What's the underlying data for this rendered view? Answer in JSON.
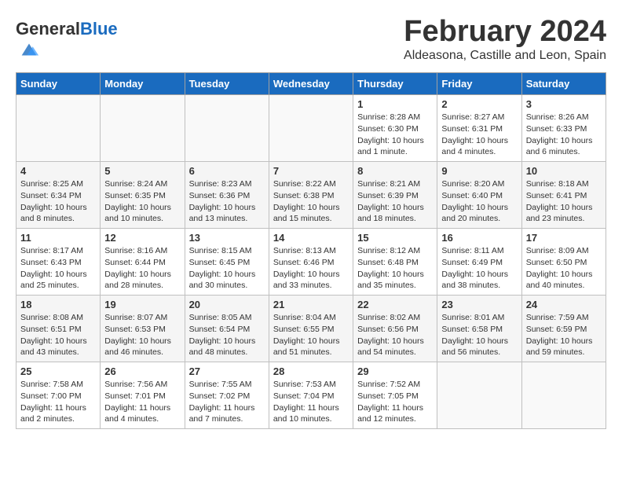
{
  "header": {
    "logo_general": "General",
    "logo_blue": "Blue",
    "month_title": "February 2024",
    "location": "Aldeasona, Castille and Leon, Spain"
  },
  "weekdays": [
    "Sunday",
    "Monday",
    "Tuesday",
    "Wednesday",
    "Thursday",
    "Friday",
    "Saturday"
  ],
  "weeks": [
    [
      {
        "day": "",
        "content": ""
      },
      {
        "day": "",
        "content": ""
      },
      {
        "day": "",
        "content": ""
      },
      {
        "day": "",
        "content": ""
      },
      {
        "day": "1",
        "content": "Sunrise: 8:28 AM\nSunset: 6:30 PM\nDaylight: 10 hours\nand 1 minute."
      },
      {
        "day": "2",
        "content": "Sunrise: 8:27 AM\nSunset: 6:31 PM\nDaylight: 10 hours\nand 4 minutes."
      },
      {
        "day": "3",
        "content": "Sunrise: 8:26 AM\nSunset: 6:33 PM\nDaylight: 10 hours\nand 6 minutes."
      }
    ],
    [
      {
        "day": "4",
        "content": "Sunrise: 8:25 AM\nSunset: 6:34 PM\nDaylight: 10 hours\nand 8 minutes."
      },
      {
        "day": "5",
        "content": "Sunrise: 8:24 AM\nSunset: 6:35 PM\nDaylight: 10 hours\nand 10 minutes."
      },
      {
        "day": "6",
        "content": "Sunrise: 8:23 AM\nSunset: 6:36 PM\nDaylight: 10 hours\nand 13 minutes."
      },
      {
        "day": "7",
        "content": "Sunrise: 8:22 AM\nSunset: 6:38 PM\nDaylight: 10 hours\nand 15 minutes."
      },
      {
        "day": "8",
        "content": "Sunrise: 8:21 AM\nSunset: 6:39 PM\nDaylight: 10 hours\nand 18 minutes."
      },
      {
        "day": "9",
        "content": "Sunrise: 8:20 AM\nSunset: 6:40 PM\nDaylight: 10 hours\nand 20 minutes."
      },
      {
        "day": "10",
        "content": "Sunrise: 8:18 AM\nSunset: 6:41 PM\nDaylight: 10 hours\nand 23 minutes."
      }
    ],
    [
      {
        "day": "11",
        "content": "Sunrise: 8:17 AM\nSunset: 6:43 PM\nDaylight: 10 hours\nand 25 minutes."
      },
      {
        "day": "12",
        "content": "Sunrise: 8:16 AM\nSunset: 6:44 PM\nDaylight: 10 hours\nand 28 minutes."
      },
      {
        "day": "13",
        "content": "Sunrise: 8:15 AM\nSunset: 6:45 PM\nDaylight: 10 hours\nand 30 minutes."
      },
      {
        "day": "14",
        "content": "Sunrise: 8:13 AM\nSunset: 6:46 PM\nDaylight: 10 hours\nand 33 minutes."
      },
      {
        "day": "15",
        "content": "Sunrise: 8:12 AM\nSunset: 6:48 PM\nDaylight: 10 hours\nand 35 minutes."
      },
      {
        "day": "16",
        "content": "Sunrise: 8:11 AM\nSunset: 6:49 PM\nDaylight: 10 hours\nand 38 minutes."
      },
      {
        "day": "17",
        "content": "Sunrise: 8:09 AM\nSunset: 6:50 PM\nDaylight: 10 hours\nand 40 minutes."
      }
    ],
    [
      {
        "day": "18",
        "content": "Sunrise: 8:08 AM\nSunset: 6:51 PM\nDaylight: 10 hours\nand 43 minutes."
      },
      {
        "day": "19",
        "content": "Sunrise: 8:07 AM\nSunset: 6:53 PM\nDaylight: 10 hours\nand 46 minutes."
      },
      {
        "day": "20",
        "content": "Sunrise: 8:05 AM\nSunset: 6:54 PM\nDaylight: 10 hours\nand 48 minutes."
      },
      {
        "day": "21",
        "content": "Sunrise: 8:04 AM\nSunset: 6:55 PM\nDaylight: 10 hours\nand 51 minutes."
      },
      {
        "day": "22",
        "content": "Sunrise: 8:02 AM\nSunset: 6:56 PM\nDaylight: 10 hours\nand 54 minutes."
      },
      {
        "day": "23",
        "content": "Sunrise: 8:01 AM\nSunset: 6:58 PM\nDaylight: 10 hours\nand 56 minutes."
      },
      {
        "day": "24",
        "content": "Sunrise: 7:59 AM\nSunset: 6:59 PM\nDaylight: 10 hours\nand 59 minutes."
      }
    ],
    [
      {
        "day": "25",
        "content": "Sunrise: 7:58 AM\nSunset: 7:00 PM\nDaylight: 11 hours\nand 2 minutes."
      },
      {
        "day": "26",
        "content": "Sunrise: 7:56 AM\nSunset: 7:01 PM\nDaylight: 11 hours\nand 4 minutes."
      },
      {
        "day": "27",
        "content": "Sunrise: 7:55 AM\nSunset: 7:02 PM\nDaylight: 11 hours\nand 7 minutes."
      },
      {
        "day": "28",
        "content": "Sunrise: 7:53 AM\nSunset: 7:04 PM\nDaylight: 11 hours\nand 10 minutes."
      },
      {
        "day": "29",
        "content": "Sunrise: 7:52 AM\nSunset: 7:05 PM\nDaylight: 11 hours\nand 12 minutes."
      },
      {
        "day": "",
        "content": ""
      },
      {
        "day": "",
        "content": ""
      }
    ]
  ]
}
